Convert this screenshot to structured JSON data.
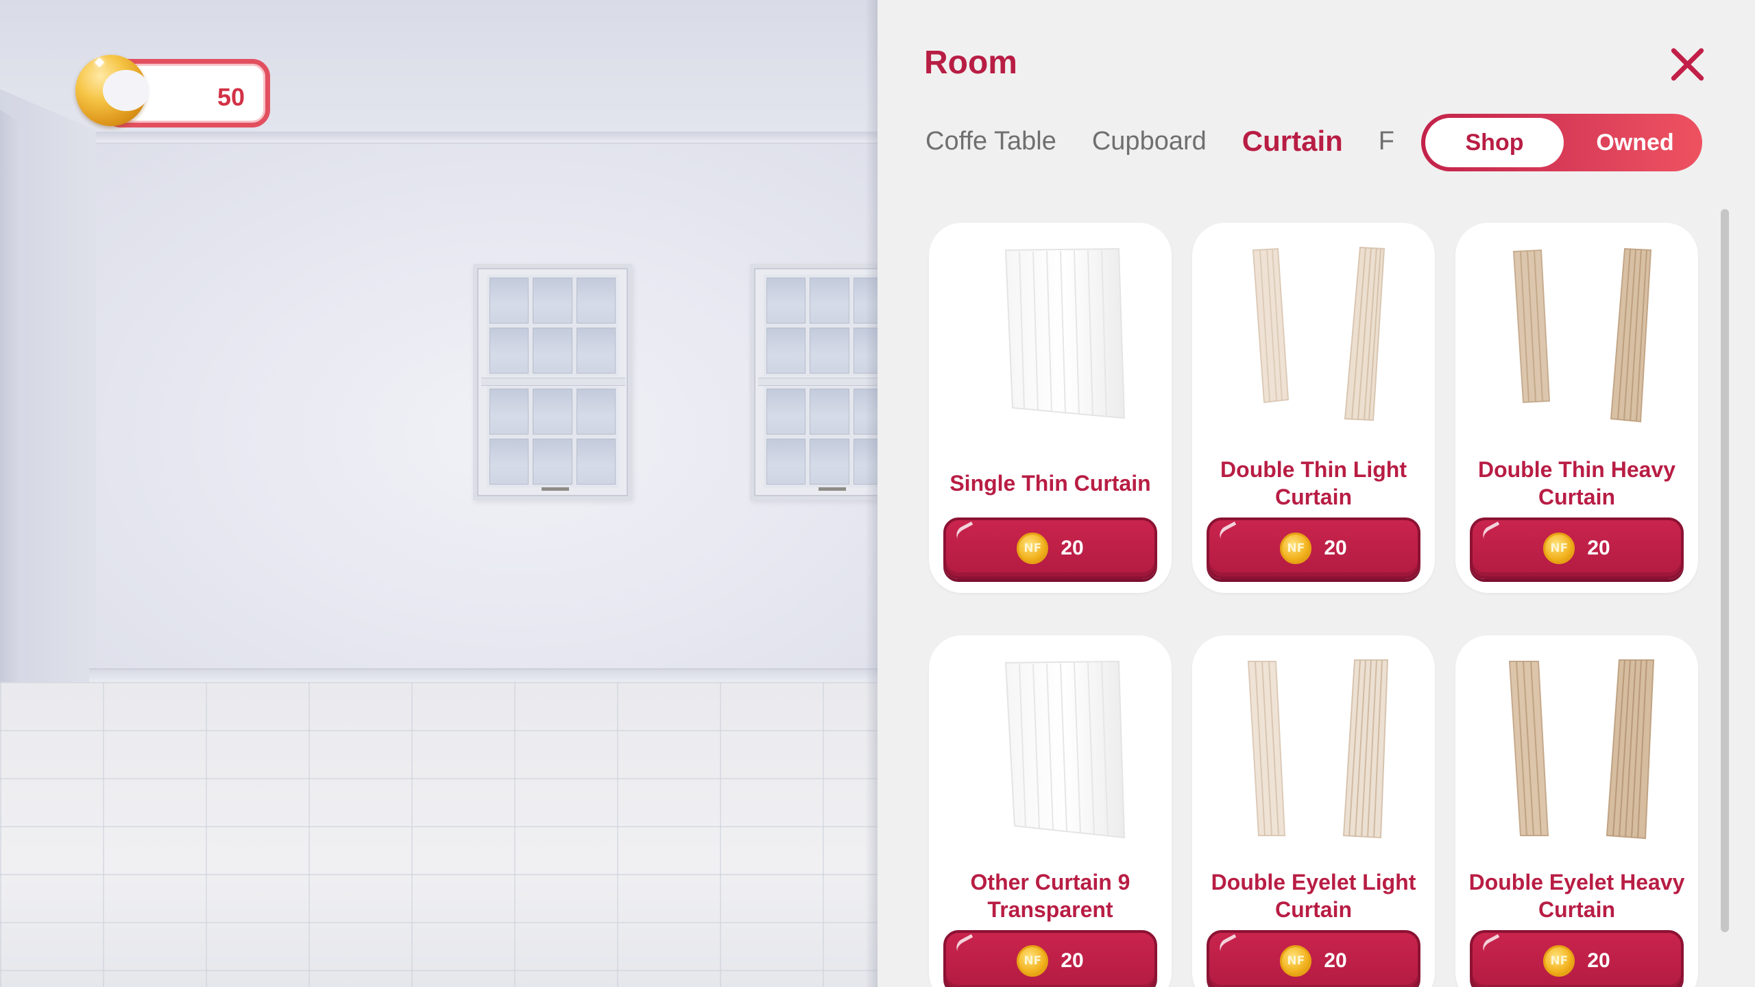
{
  "hud": {
    "coins": "50"
  },
  "panel": {
    "title": "Room",
    "tabs": [
      {
        "label": "Coffe Table"
      },
      {
        "label": "Cupboard"
      },
      {
        "label": "Curtain",
        "active": true
      },
      {
        "label": "F"
      }
    ],
    "toggle": {
      "shop": "Shop",
      "owned": "Owned",
      "selected": "Shop"
    },
    "items": [
      {
        "name": "Single Thin Curtain",
        "price": "20",
        "icon": "single-sheer-curtain"
      },
      {
        "name": "Double Thin Light Curtain",
        "price": "20",
        "icon": "double-thin-light-curtain"
      },
      {
        "name": "Double Thin Heavy Curtain",
        "price": "20",
        "icon": "double-thin-heavy-curtain"
      },
      {
        "name": "Other Curtain 9 Transparent",
        "price": "20",
        "icon": "transparent-curtain"
      },
      {
        "name": "Double Eyelet Light Curtain",
        "price": "20",
        "icon": "double-eyelet-light-curtain"
      },
      {
        "name": "Double Eyelet Heavy Curtain",
        "price": "20",
        "icon": "double-eyelet-heavy-curtain"
      }
    ],
    "currency_icon_text": "NF"
  },
  "colors": {
    "accent": "#b81d44",
    "button": "#c9244d",
    "coin": "#f2b21e",
    "panel_bg": "#f0f0f0"
  }
}
